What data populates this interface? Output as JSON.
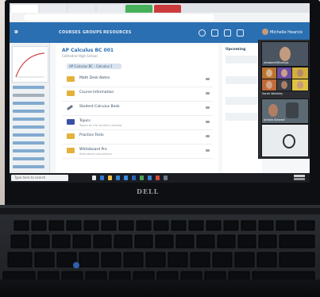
{
  "browser": {
    "tabs_count": 6
  },
  "canvas": {
    "brand": "ə",
    "nav": [
      "COURSES",
      "GROUPS",
      "RESOURCES"
    ],
    "user_name": "Michelle Hearick"
  },
  "course": {
    "title": "AP Calculus BC 001",
    "subtitle": "Cathedral High School",
    "chip": "AP Calculus BC - Calculus 1",
    "rows": [
      {
        "title": "Math Desk Notes",
        "sub": "",
        "color": "#e3b23c"
      },
      {
        "title": "Course Information",
        "sub": "",
        "color": "#e3b23c"
      },
      {
        "title": "Student Calculus Book",
        "sub": "",
        "color": "#6b7a8a"
      },
      {
        "title": "Topics",
        "sub": "Topics on the student calendar",
        "color": "#3a4fa8"
      },
      {
        "title": "Practice Tests",
        "sub": "",
        "color": "#e3b23c"
      },
      {
        "title": "Whiteboard Pro",
        "sub": "Attendance documents",
        "color": "#e3b23c"
      }
    ]
  },
  "upcoming": {
    "label": "Upcoming"
  },
  "call": {
    "host": "elizabeth@bmhgs",
    "names": [
      "Sarah Weekley",
      "Amelia Stewart"
    ]
  },
  "taskbar": {
    "search": "Type here to search"
  },
  "laptop": {
    "brand": "DELL"
  }
}
